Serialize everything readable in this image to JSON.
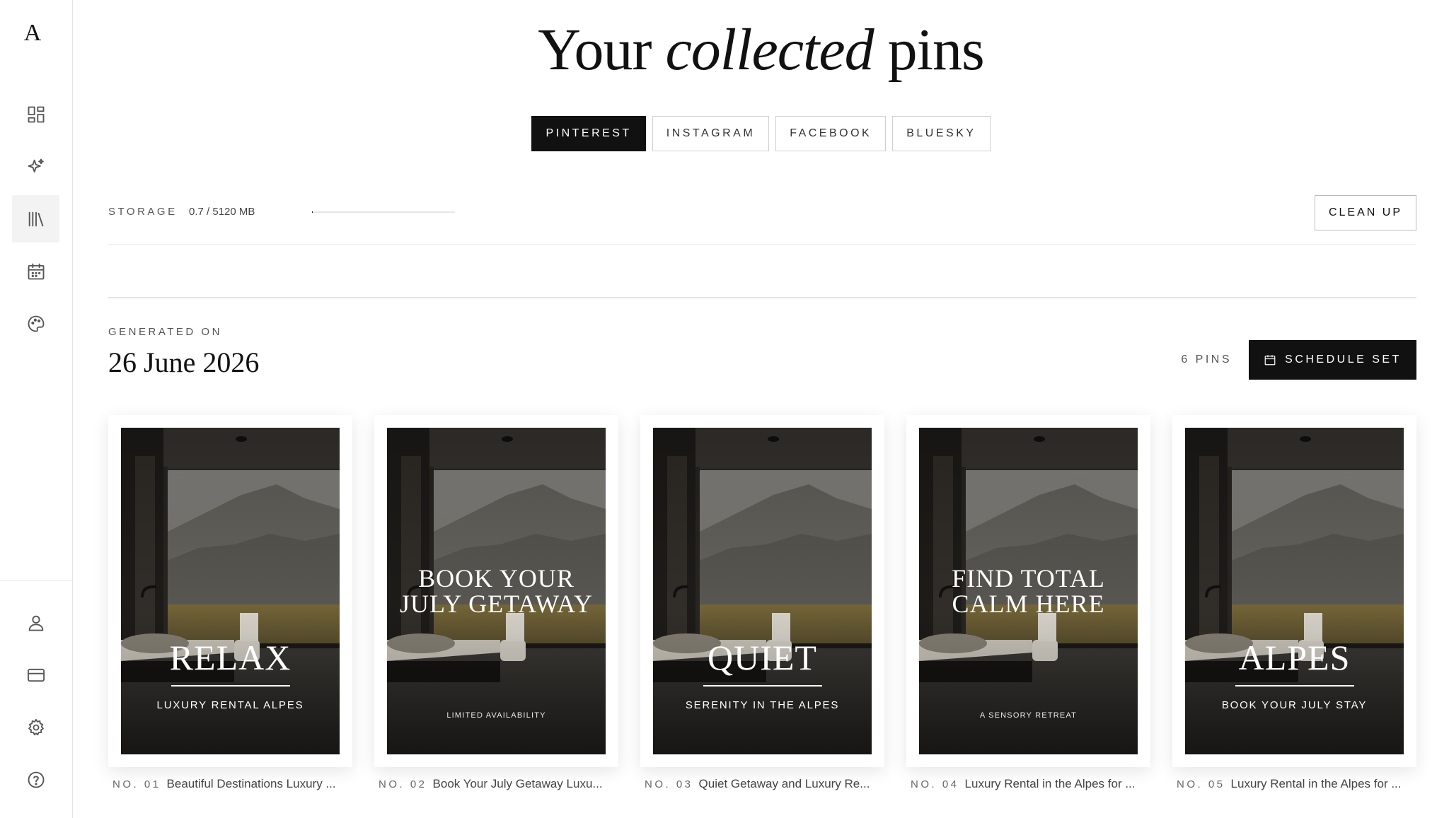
{
  "sidebar": {
    "logo": "A",
    "nav": [
      {
        "icon": "dashboard-icon"
      },
      {
        "icon": "sparkle-icon"
      },
      {
        "icon": "library-icon",
        "active": true
      },
      {
        "icon": "calendar-icon"
      },
      {
        "icon": "palette-icon"
      }
    ],
    "bottom": [
      {
        "icon": "user-icon"
      },
      {
        "icon": "credit-card-icon"
      },
      {
        "icon": "settings-gear-icon"
      },
      {
        "icon": "help-icon"
      }
    ]
  },
  "header": {
    "title_pre": "Your ",
    "title_em": "collected",
    "title_post": " pins"
  },
  "platform_tabs": [
    {
      "label": "PINTEREST",
      "active": true
    },
    {
      "label": "INSTAGRAM",
      "active": false
    },
    {
      "label": "FACEBOOK",
      "active": false
    },
    {
      "label": "BLUESKY",
      "active": false
    }
  ],
  "storage": {
    "label": "STORAGE",
    "value": "0.7 / 5120 MB",
    "used_fraction": 0.0001,
    "cleanup_label": "CLEAN UP"
  },
  "generated": {
    "label": "GENERATED ON",
    "date": "26 June 2026",
    "pin_count": "6 PINS",
    "schedule_label": "SCHEDULE SET"
  },
  "pins": [
    {
      "no": "NO. 01",
      "caption": "Beautiful Destinations Luxury ...",
      "title": "RELAX",
      "layout": "big",
      "sub": "LUXURY RENTAL ALPES"
    },
    {
      "no": "NO. 02",
      "caption": "Book Your July Getaway Luxu...",
      "title_lines": [
        "BOOK YOUR",
        "JULY GETAWAY"
      ],
      "layout": "two",
      "sub": "LIMITED AVAILABILITY"
    },
    {
      "no": "NO. 03",
      "caption": "Quiet Getaway and Luxury Re...",
      "title": "QUIET",
      "layout": "big",
      "sub": "SERENITY IN THE ALPES"
    },
    {
      "no": "NO. 04",
      "caption": "Luxury Rental in the Alpes for ...",
      "title_lines": [
        "FIND TOTAL",
        "CALM HERE"
      ],
      "layout": "two",
      "sub": "A SENSORY RETREAT"
    },
    {
      "no": "NO. 05",
      "caption": "Luxury Rental in the Alpes for ...",
      "title": "ALPES",
      "layout": "big",
      "sub": "BOOK YOUR JULY STAY"
    }
  ]
}
